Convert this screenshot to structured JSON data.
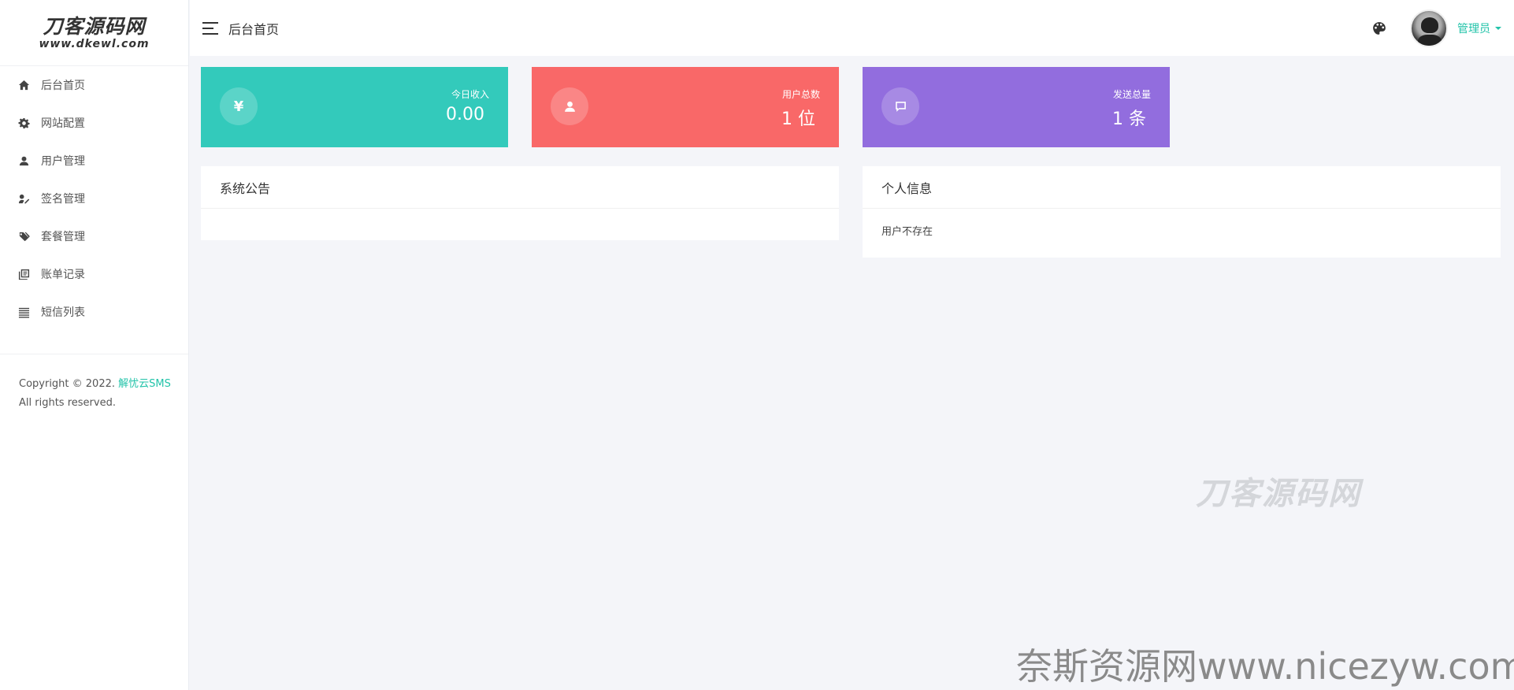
{
  "logo": {
    "main": "刀客源码网",
    "sub": "www.dkewl.com"
  },
  "sidebar": {
    "items": [
      {
        "label": "后台首页",
        "icon": "home-icon"
      },
      {
        "label": "网站配置",
        "icon": "gear-icon"
      },
      {
        "label": "用户管理",
        "icon": "user-icon"
      },
      {
        "label": "签名管理",
        "icon": "signature-icon"
      },
      {
        "label": "套餐管理",
        "icon": "tags-icon"
      },
      {
        "label": "账单记录",
        "icon": "records-icon"
      },
      {
        "label": "短信列表",
        "icon": "list-icon"
      }
    ],
    "copyright_prefix": "Copyright © 2022. ",
    "copyright_brand": "解忧云SMS",
    "copyright_suffix": "All rights reserved."
  },
  "header": {
    "title": "后台首页",
    "user_label": "管理员"
  },
  "stats": [
    {
      "label": "今日收入",
      "value": "0.00",
      "icon": "yen-icon",
      "symbol": "¥",
      "color": "#33cabb"
    },
    {
      "label": "用户总数",
      "value": "1 位",
      "icon": "user-icon",
      "color": "#f96868"
    },
    {
      "label": "发送总量",
      "value": "1 条",
      "icon": "message-icon",
      "color": "#926dde"
    }
  ],
  "panels": {
    "notice": {
      "title": "系统公告",
      "body": ""
    },
    "profile": {
      "title": "个人信息",
      "body": "用户不存在"
    }
  },
  "watermarks": {
    "logo": "刀客源码网",
    "bottom": "奈斯资源网www.nicezyw.com"
  },
  "colors": {
    "accent": "#22c3a9",
    "green": "#33cabb",
    "red": "#f96868",
    "purple": "#926dde",
    "background": "#f4f5f9"
  }
}
